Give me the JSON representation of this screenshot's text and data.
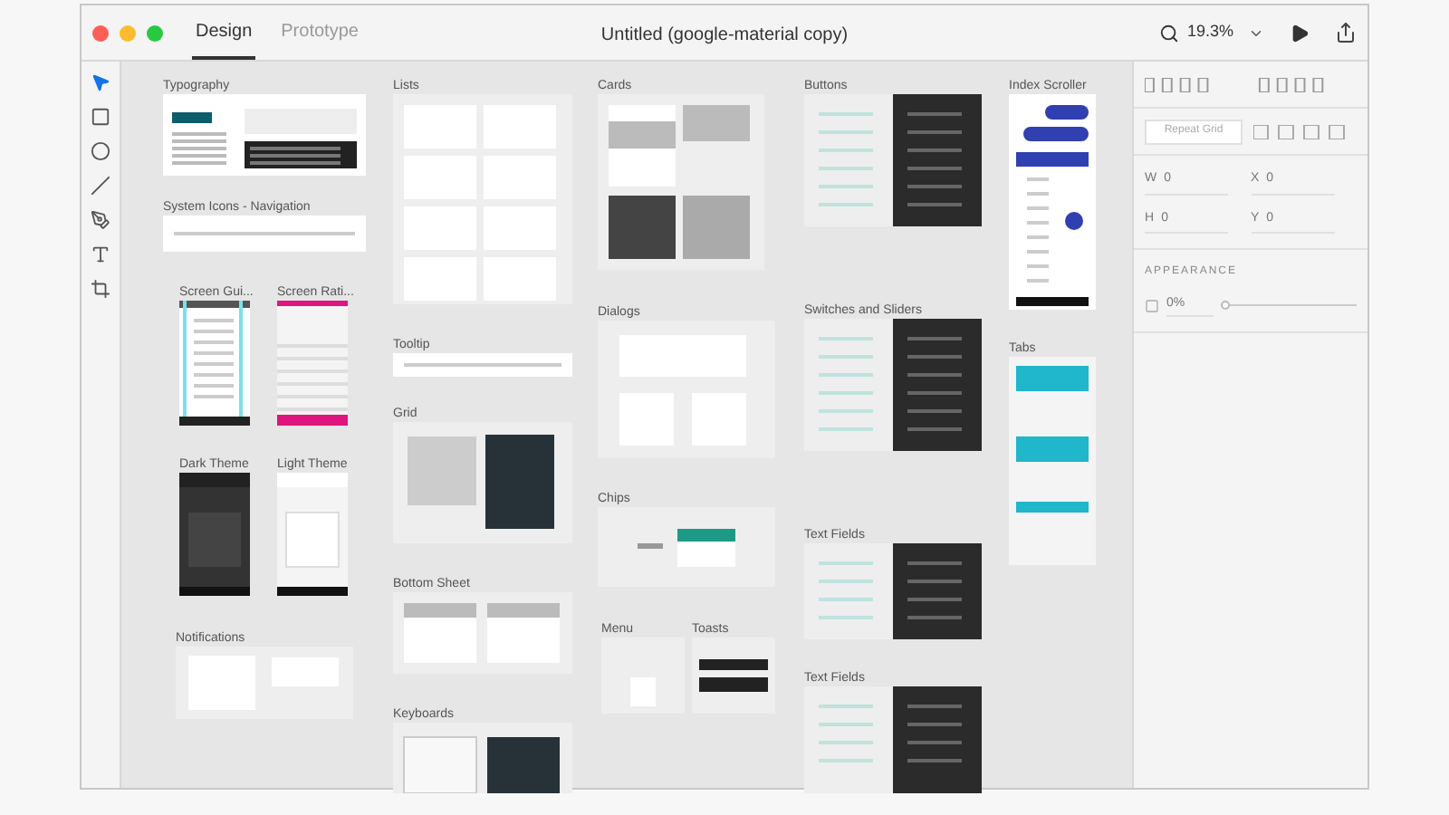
{
  "window": {
    "title": "Untitled (google-material copy)"
  },
  "tabs": [
    {
      "label": "Design",
      "selected": true
    },
    {
      "label": "Prototype",
      "selected": false
    }
  ],
  "zoom": {
    "value": "19.3%"
  },
  "tools": [
    {
      "kind": "select",
      "selected": true
    },
    {
      "kind": "rectangle",
      "selected": false
    },
    {
      "kind": "ellipse",
      "selected": false
    },
    {
      "kind": "line",
      "selected": false
    },
    {
      "kind": "pen",
      "selected": false
    },
    {
      "kind": "text",
      "selected": false
    },
    {
      "kind": "artboard",
      "selected": false
    }
  ],
  "artboards": [
    {
      "name": "Typography",
      "kind": "typography"
    },
    {
      "name": "System Icons - Navigation",
      "kind": "icons"
    },
    {
      "name": "Screen Gui...",
      "kind": "guides"
    },
    {
      "name": "Screen Rati...",
      "kind": "ratios"
    },
    {
      "name": "Dark Theme",
      "kind": "darkphone"
    },
    {
      "name": "Light Theme",
      "kind": "lightphone"
    },
    {
      "name": "Notifications",
      "kind": "notifications"
    },
    {
      "name": "Lists",
      "kind": "lists"
    },
    {
      "name": "Tooltip",
      "kind": "icons"
    },
    {
      "name": "Grid",
      "kind": "grid"
    },
    {
      "name": "Bottom Sheet",
      "kind": "sheet"
    },
    {
      "name": "Keyboards",
      "kind": "keyboards"
    },
    {
      "name": "Cards",
      "kind": "cards"
    },
    {
      "name": "Dialogs",
      "kind": "dialogs"
    },
    {
      "name": "Chips",
      "kind": "chips"
    },
    {
      "name": "Menu",
      "kind": "menu"
    },
    {
      "name": "Toasts",
      "kind": "toasts"
    },
    {
      "name": "Buttons",
      "kind": "split"
    },
    {
      "name": "Switches and Sliders",
      "kind": "split"
    },
    {
      "name": "Text Fields",
      "kind": "split"
    },
    {
      "name": "Text Fields",
      "kind": "split"
    },
    {
      "name": "Index Scroller",
      "kind": "scroller"
    },
    {
      "name": "Tabs",
      "kind": "tabs"
    }
  ],
  "properties": {
    "repeat_grid": "Repeat Grid",
    "fields": [
      {
        "label": "W",
        "value": "0"
      },
      {
        "label": "X",
        "value": "0"
      },
      {
        "label": "H",
        "value": "0"
      },
      {
        "label": "Y",
        "value": "0"
      }
    ],
    "appearance": {
      "heading": "APPEARANCE",
      "opacity": "0%",
      "level": 0
    }
  }
}
